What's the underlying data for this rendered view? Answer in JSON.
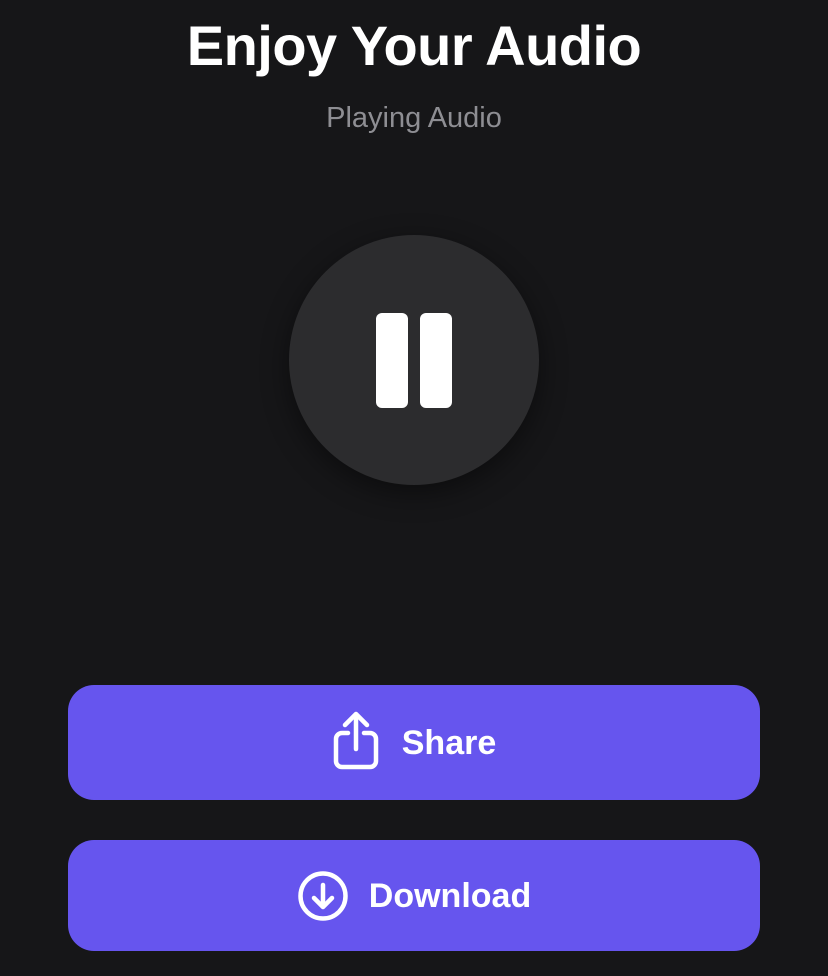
{
  "header": {
    "title": "Enjoy Your Audio",
    "status": "Playing Audio"
  },
  "player": {
    "state": "playing",
    "toggle_icon": "pause-icon"
  },
  "actions": {
    "share": {
      "label": "Share",
      "icon": "share-icon"
    },
    "download": {
      "label": "Download",
      "icon": "download-icon"
    }
  },
  "colors": {
    "background": "#161618",
    "accent": "#6655ee",
    "control_circle": "#2c2c2e",
    "subtitle": "#8e8e93",
    "text": "#ffffff"
  }
}
